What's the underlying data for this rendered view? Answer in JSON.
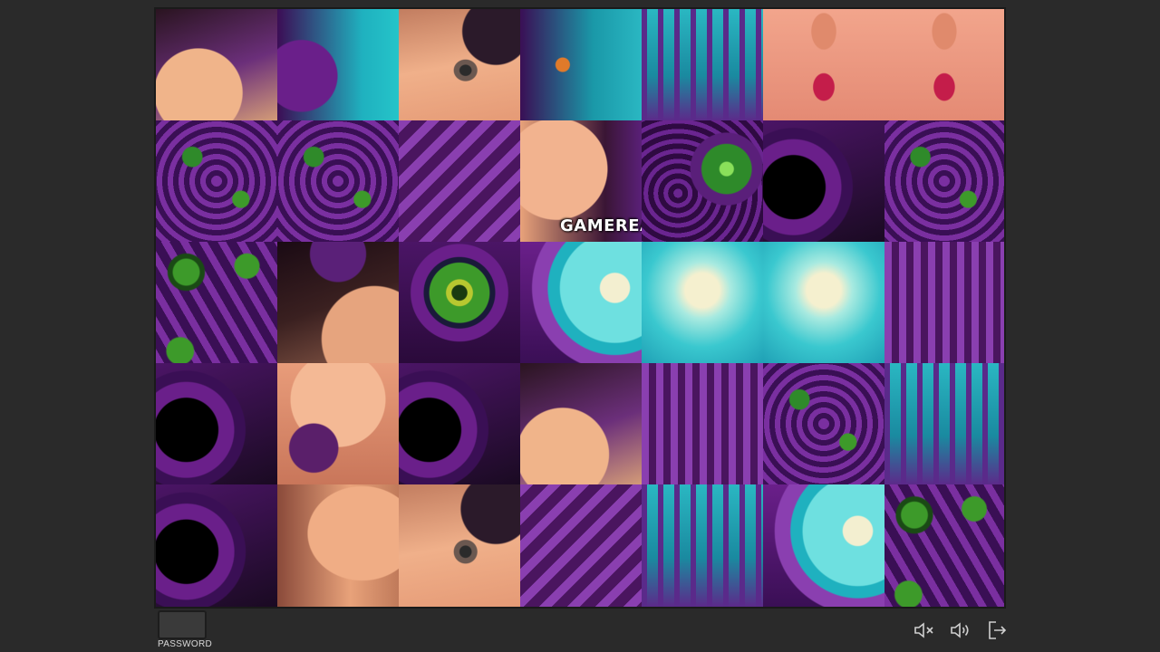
{
  "game": {
    "password_label": "PASSWORD",
    "grid_columns": 7,
    "grid_rows": 5,
    "watermark_text": "GAMEREA",
    "watermark_tile": 10
  },
  "palette": {
    "background": "#2a2a2a",
    "purple": "#6a1f8a",
    "teal": "#1fb1bf",
    "skin": "#e8a27a",
    "green": "#3d9a2a"
  },
  "tiles": [
    {
      "theme": "skin-hair"
    },
    {
      "theme": "purple-teal"
    },
    {
      "theme": "face-eye"
    },
    {
      "theme": "purple-teal-figure"
    },
    {
      "theme": "teal-city"
    },
    {
      "theme": "face-lips"
    },
    {
      "theme": "face-lips"
    },
    {
      "theme": "purple-machine"
    },
    {
      "theme": "purple-machine"
    },
    {
      "theme": "purple-pipes"
    },
    {
      "theme": "skin-shoulder"
    },
    {
      "theme": "purple-eye-green"
    },
    {
      "theme": "purple-ring-dark"
    },
    {
      "theme": "purple-machine"
    },
    {
      "theme": "purple-green-eyes"
    },
    {
      "theme": "skin-hair-dark"
    },
    {
      "theme": "green-eye-close"
    },
    {
      "theme": "purple-ring-teal"
    },
    {
      "theme": "teal-glow"
    },
    {
      "theme": "teal-glow"
    },
    {
      "theme": "purple-city"
    },
    {
      "theme": "purple-ring-dark"
    },
    {
      "theme": "skin-mouth"
    },
    {
      "theme": "purple-ring-dark"
    },
    {
      "theme": "skin-hair"
    },
    {
      "theme": "purple-city"
    },
    {
      "theme": "purple-machine"
    },
    {
      "theme": "teal-city"
    },
    {
      "theme": "purple-ring-dark"
    },
    {
      "theme": "skin-neck"
    },
    {
      "theme": "face-eye"
    },
    {
      "theme": "purple-pipes"
    },
    {
      "theme": "teal-city"
    },
    {
      "theme": "purple-ring-teal"
    },
    {
      "theme": "purple-green-eyes"
    }
  ],
  "controls": [
    {
      "name": "mute-icon"
    },
    {
      "name": "volume-icon"
    },
    {
      "name": "exit-icon"
    }
  ]
}
